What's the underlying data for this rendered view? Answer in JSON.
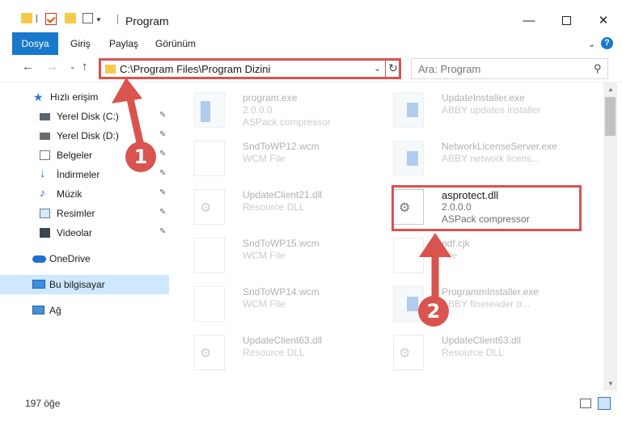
{
  "window": {
    "title": "Program",
    "min_glyph": "—",
    "close_glyph": "✕"
  },
  "ribbon": {
    "tabs": [
      "Dosya",
      "Giriş",
      "Paylaş",
      "Görünüm"
    ],
    "expand_glyph": "⌄",
    "help_glyph": "?"
  },
  "navigation": {
    "back_glyph": "←",
    "forward_glyph": "→",
    "recent_glyph": "⌄",
    "up_glyph": "↑",
    "address": "C:\\Program Files\\Program Dizini",
    "address_dropdown_glyph": "⌄",
    "refresh_glyph": "↻",
    "search_placeholder": "Ara: Program",
    "search_glyph": "⚲"
  },
  "sidebar": {
    "items": [
      {
        "label": "Hızlı erişim",
        "icon": "star-icon",
        "pinned": false
      },
      {
        "label": "Yerel Disk (C:)",
        "icon": "drive-icon",
        "pinned": true
      },
      {
        "label": "Yerel Disk (D:)",
        "icon": "drive-icon",
        "pinned": true
      },
      {
        "label": "Belgeler",
        "icon": "documents-icon",
        "pinned": true
      },
      {
        "label": "İndirmeler",
        "icon": "download-icon",
        "pinned": true
      },
      {
        "label": "Müzik",
        "icon": "music-icon",
        "pinned": true
      },
      {
        "label": "Resimler",
        "icon": "pictures-icon",
        "pinned": true
      },
      {
        "label": "Videolar",
        "icon": "videos-icon",
        "pinned": true
      },
      {
        "label": "OneDrive",
        "icon": "cloud-icon",
        "pinned": false
      },
      {
        "label": "Bu bilgisayar",
        "icon": "computer-icon",
        "pinned": false,
        "selected": true
      },
      {
        "label": "Ağ",
        "icon": "network-icon",
        "pinned": false
      }
    ],
    "pin_glyph": "📌"
  },
  "files": {
    "left": [
      {
        "name": "program.exe",
        "line1": "2.0.0.0",
        "line2": "ASPack compressor",
        "icon": "exe"
      },
      {
        "name": "SndToWP12.wcm",
        "line1": "WCM File",
        "line2": "",
        "icon": "doc"
      },
      {
        "name": "UpdateClient21.dll",
        "line1": "Resource DLL",
        "line2": "",
        "icon": "gear"
      },
      {
        "name": "SndToWP15.wcm",
        "line1": "WCM File",
        "line2": "",
        "icon": "doc"
      },
      {
        "name": "SndToWP14.wcm",
        "line1": "WCM File",
        "line2": "",
        "icon": "doc"
      },
      {
        "name": "UpdateClient63.dll",
        "line1": "Resource DLL",
        "line2": "",
        "icon": "gear"
      }
    ],
    "right": [
      {
        "name": "UpdateInstaller.exe",
        "line1": "ABBY updates installer",
        "line2": "",
        "icon": "win"
      },
      {
        "name": "NetworkLicenseServer.exe",
        "line1": "ABBY network licens...",
        "line2": "",
        "icon": "win"
      },
      {
        "name": "asprotect.dll",
        "line1": "2.0.0.0",
        "line2": "ASPack compressor",
        "icon": "gear"
      },
      {
        "name": "ndf.cjk",
        "line1": "File",
        "line2": "",
        "icon": "doc"
      },
      {
        "name": "ProgrammInstaller.exe",
        "line1": "ABBY finereader tr...",
        "line2": "",
        "icon": "win"
      },
      {
        "name": "UpdateClient63.dll",
        "line1": "Resource DLL",
        "line2": "",
        "icon": "gear"
      }
    ]
  },
  "status": {
    "item_count": "197 öğe"
  },
  "annotations": {
    "badge1": "1",
    "badge2": "2",
    "color": "#d9534f"
  }
}
